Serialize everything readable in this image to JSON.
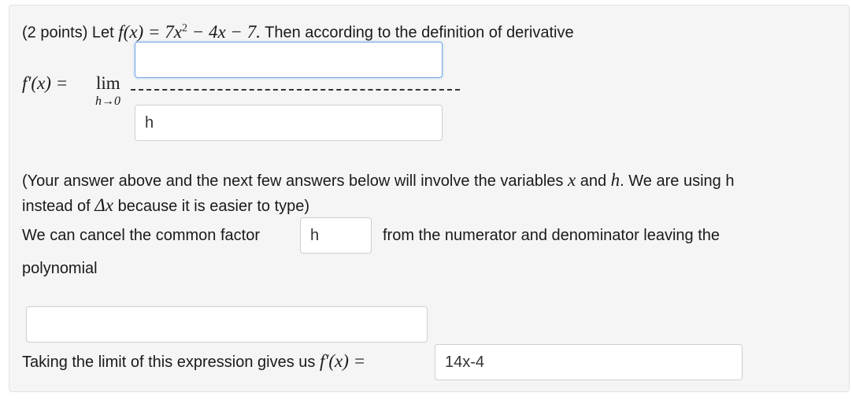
{
  "header": {
    "points": "(2 points) Let",
    "fx": "f(x) = 7x",
    "exp": "2",
    "rest": " − 4x − 7.",
    "after": " Then according to the definition of derivative"
  },
  "limit": {
    "fprime": "f′(x) =",
    "lim": "lim",
    "sub": "h→0"
  },
  "inputs": {
    "numerator": "",
    "denominator": "h",
    "common_factor": "h",
    "polynomial": "",
    "final": "14x-4"
  },
  "note": {
    "line1_a": "(Your answer above and the next few answers below will involve the variables ",
    "var_x": "x",
    "and": " and ",
    "var_h": "h",
    "line1_b": ". We are using h",
    "line2_a": "instead of ",
    "delta_x": "Δx",
    "line2_b": " because it is easier to type)"
  },
  "cancel": {
    "before": "We can cancel the common factor",
    "after": "from the numerator and denominator leaving the",
    "line2": "polynomial"
  },
  "final": {
    "text": "Taking the limit of this expression gives us",
    "fprime": "f′(x) ="
  }
}
